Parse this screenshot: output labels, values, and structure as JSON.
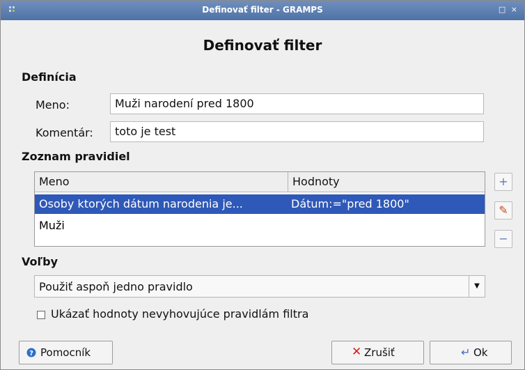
{
  "window": {
    "title": "Definovať filter - GRAMPS",
    "controls": "□ ×"
  },
  "dialog": {
    "heading": "Definovať filter"
  },
  "definition": {
    "section_label": "Definícia",
    "name_label": "Meno:",
    "name_value": "Muži narodení pred 1800",
    "comment_label": "Komentár:",
    "comment_value": "toto je test"
  },
  "rules": {
    "section_label": "Zoznam pravidiel",
    "columns": [
      "Meno",
      "Hodnoty"
    ],
    "rows": [
      {
        "name": "Osoby ktorých dátum narodenia je...",
        "values": "Dátum:=\"pred 1800\"",
        "selected": true
      },
      {
        "name": "Muži",
        "values": "",
        "selected": false
      }
    ],
    "side_buttons": {
      "add": "+",
      "edit": "✎",
      "remove": "−"
    }
  },
  "options": {
    "section_label": "Voľby",
    "selected": "Použiť aspoň jedno pravidlo",
    "checkbox_label": "Ukázať hodnoty nevyhovujúce pravidlám filtra",
    "checkbox_checked": false
  },
  "buttons": {
    "help": "Pomocník",
    "cancel": "Zrušiť",
    "ok": "Ok"
  },
  "colors": {
    "title_bar": "#4f73a6",
    "selection": "#2f59b8",
    "cancel_icon": "#d02020",
    "help_icon": "#2f6ec8"
  }
}
